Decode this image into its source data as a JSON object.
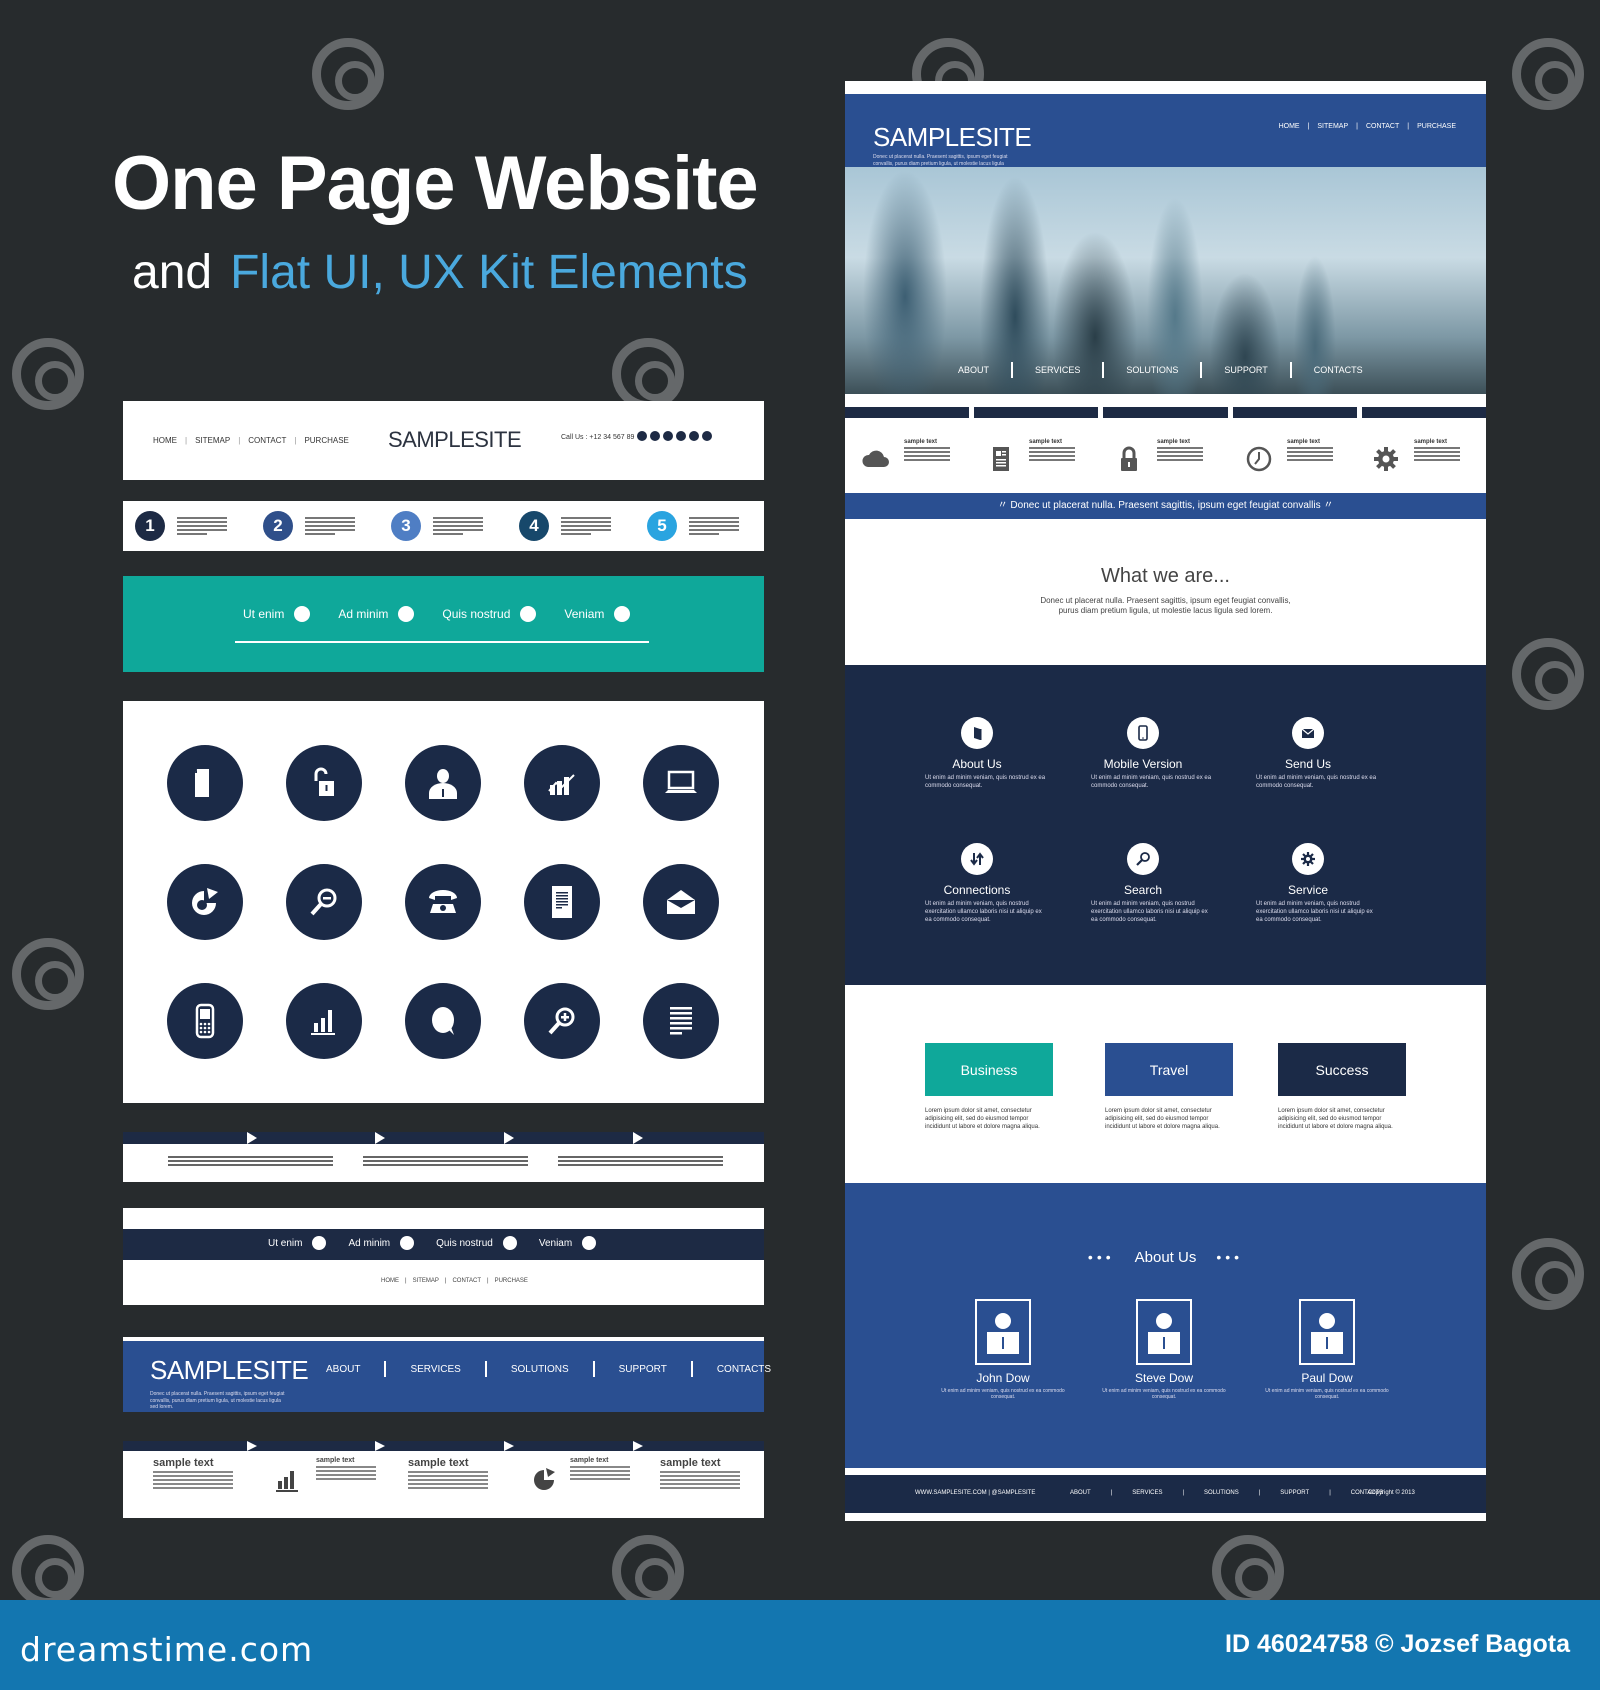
{
  "heading": {
    "title": "One Page Website",
    "sub_prefix": "and",
    "sub_accent": "Flat UI, UX Kit Elements",
    "accent_color": "#4aa9de"
  },
  "colors": {
    "navy": "#1b2a47",
    "blue": "#2a4f91",
    "teal": "#0fa89a",
    "background": "#272b2d",
    "bottom_bar": "#1376b0"
  },
  "header_panel": {
    "nav": [
      "HOME",
      "SITEMAP",
      "CONTACT",
      "PURCHASE"
    ],
    "logo": "SAMPLESITE",
    "call_us": "Call Us : +12 34 567 89",
    "social_icons": [
      "social-icon-1",
      "social-icon-2",
      "social-icon-3",
      "social-icon-4",
      "social-icon-5",
      "social-icon-6"
    ]
  },
  "steps_panel": {
    "steps": [
      {
        "number": "1",
        "color": "#1d2a44"
      },
      {
        "number": "2",
        "color": "#2f4f8a"
      },
      {
        "number": "3",
        "color": "#4f7ec4"
      },
      {
        "number": "4",
        "color": "#17486b"
      },
      {
        "number": "5",
        "color": "#2aa4e0"
      }
    ]
  },
  "teal_nav": {
    "items": [
      {
        "label": "Ut enim",
        "icon": "lock-icon"
      },
      {
        "label": "Ad minim",
        "icon": "mobile-icon"
      },
      {
        "label": "Quis nostrud",
        "icon": "target-icon"
      },
      {
        "label": "Veniam",
        "icon": "phone-icon"
      }
    ]
  },
  "icon_grid": {
    "icons": [
      "document-icon",
      "unlock-icon",
      "user-icon",
      "growth-chart-icon",
      "laptop-icon",
      "pie-chart-icon",
      "zoom-out-icon",
      "telephone-icon",
      "text-document-icon",
      "open-envelope-icon",
      "cellphone-icon",
      "bar-chart-icon",
      "speech-bubble-icon",
      "zoom-in-icon",
      "text-lines-icon"
    ]
  },
  "dark_nav_panel": {
    "items": [
      {
        "label": "Ut enim",
        "icon": "lock-icon"
      },
      {
        "label": "Ad minim",
        "icon": "mobile-icon"
      },
      {
        "label": "Quis nostrud",
        "icon": "target-icon"
      },
      {
        "label": "Veniam",
        "icon": "phone-icon"
      }
    ],
    "sub_nav": [
      "HOME",
      "SITEMAP",
      "CONTACT",
      "PURCHASE"
    ]
  },
  "blue_header_panel": {
    "logo": "SAMPLESITE",
    "caption": "Donec ut placerat nulla. Praesent sagittis, ipsum eget feugiat convallis, purus diam pretium ligula, ut molestie lacus ligula sed lorem.",
    "nav": [
      "ABOUT",
      "SERVICES",
      "SOLUTIONS",
      "SUPPORT",
      "CONTACTS"
    ]
  },
  "sample_panel": {
    "columns": [
      {
        "heading": "sample text",
        "icon": null
      },
      {
        "heading": "sample text",
        "icon": "bar-chart-icon"
      },
      {
        "heading": "sample text",
        "icon": null
      },
      {
        "heading": "sample text",
        "icon": "pie-chart-icon"
      },
      {
        "heading": "sample text",
        "icon": null
      }
    ]
  },
  "mockup": {
    "logo": "SAMPLESITE",
    "caption": "Donec ut placerat nulla. Praesent sagittis, ipsum eget feugiat convallis, purus diam pretium ligula, ut molestie lacus ligula sed lorem.",
    "top_nav": [
      "HOME",
      "SITEMAP",
      "CONTACT",
      "PURCHASE"
    ],
    "hero_nav": [
      "ABOUT",
      "SERVICES",
      "SOLUTIONS",
      "SUPPORT",
      "CONTACTS"
    ],
    "features": [
      {
        "label": "sample text",
        "icon": "cloud-icon"
      },
      {
        "label": "sample text",
        "icon": "newspaper-icon"
      },
      {
        "label": "sample text",
        "icon": "padlock-icon"
      },
      {
        "label": "sample text",
        "icon": "clock-icon"
      },
      {
        "label": "sample text",
        "icon": "gear-icon"
      }
    ],
    "quote": "Donec ut placerat nulla. Praesent sagittis, ipsum eget feugiat convallis",
    "what_title": "What we are...",
    "what_text": "Donec ut placerat nulla. Praesent sagittis, ipsum eget feugiat convallis, purus diam pretium ligula, ut molestie lacus ligula sed lorem.",
    "services": [
      {
        "title": "About Us",
        "icon": "book-icon",
        "text": "Ut enim ad minim veniam, quis nostrud ex ea commodo consequat."
      },
      {
        "title": "Mobile Version",
        "icon": "mobile-icon",
        "text": "Ut enim ad minim veniam, quis nostrud ex ea commodo consequat."
      },
      {
        "title": "Send Us",
        "icon": "envelope-icon",
        "text": "Ut enim ad minim veniam, quis nostrud ex ea commodo consequat."
      },
      {
        "title": "Connections",
        "icon": "connections-icon",
        "text": "Ut enim ad minim veniam, quis nostrud exercitation ullamco laboris nisi ut aliquip ex ea commodo consequat."
      },
      {
        "title": "Search",
        "icon": "search-icon",
        "text": "Ut enim ad minim veniam, quis nostrud exercitation ullamco laboris nisi ut aliquip ex ea commodo consequat."
      },
      {
        "title": "Service",
        "icon": "gear-icon",
        "text": "Ut enim ad minim veniam, quis nostrud exercitation ullamco laboris nisi ut aliquip ex ea commodo consequat."
      }
    ],
    "cards": [
      {
        "title": "Business",
        "color": "#0fa89a",
        "text": "Lorem ipsum dolor sit amet, consectetur adipisicing elit, sed do eiusmod tempor incididunt ut labore et dolore magna aliqua."
      },
      {
        "title": "Travel",
        "color": "#2a4f91",
        "text": "Lorem ipsum dolor sit amet, consectetur adipisicing elit, sed do eiusmod tempor incididunt ut labore et dolore magna aliqua."
      },
      {
        "title": "Success",
        "color": "#1b2a47",
        "text": "Lorem ipsum dolor sit amet, consectetur adipisicing elit, sed do eiusmod tempor incididunt ut labore et dolore magna aliqua."
      }
    ],
    "about_title": "About Us",
    "people": [
      {
        "name": "John Dow",
        "text": "Ut enim ad minim veniam, quis nostrud ex ea commodo consequat."
      },
      {
        "name": "Steve Dow",
        "text": "Ut enim ad minim veniam, quis nostrud ex ea commodo consequat."
      },
      {
        "name": "Paul Dow",
        "text": "Ut enim ad minim veniam, quis nostrud ex ea commodo consequat."
      }
    ],
    "footer": {
      "site": "WWW.SAMPLESITE.COM  |  @SAMPLESITE",
      "nav": [
        "ABOUT",
        "SERVICES",
        "SOLUTIONS",
        "SUPPORT",
        "CONTACTS"
      ],
      "copyright": "Copyright © 2013"
    }
  },
  "bottom_bar": {
    "brand": "dreamstime.com",
    "credit": "ID 46024758 © Jozsef Bagota"
  }
}
